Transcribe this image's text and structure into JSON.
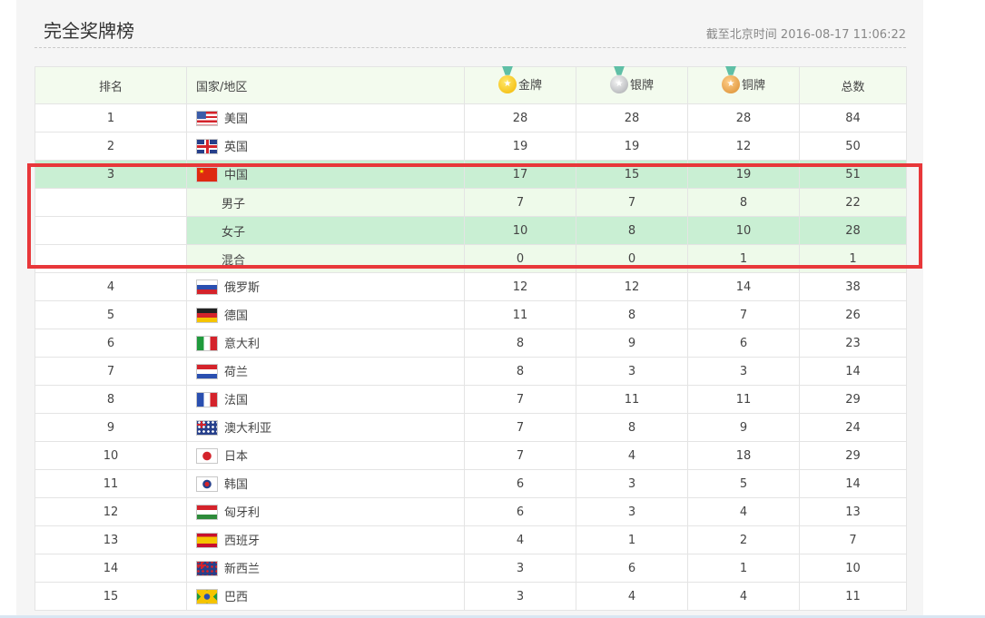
{
  "page": {
    "title": "完全奖牌榜",
    "updated": "截至北京时间 2016-08-17 11:06:22"
  },
  "table": {
    "headers": {
      "rank": "排名",
      "country": "国家/地区",
      "gold": "金牌",
      "silver": "银牌",
      "bronze": "铜牌",
      "total": "总数"
    },
    "rows": [
      {
        "rank": "1",
        "country": "美国",
        "gold": "28",
        "silver": "28",
        "bronze": "28",
        "total": "84",
        "flag": "us-flag-icon"
      },
      {
        "rank": "2",
        "country": "英国",
        "gold": "19",
        "silver": "19",
        "bronze": "12",
        "total": "50",
        "flag": "uk-flag-icon"
      },
      {
        "rank": "3",
        "country": "中国",
        "gold": "17",
        "silver": "15",
        "bronze": "19",
        "total": "51",
        "flag": "china-flag-icon"
      },
      {
        "rank": "4",
        "country": "俄罗斯",
        "gold": "12",
        "silver": "12",
        "bronze": "14",
        "total": "38",
        "flag": "russia-flag-icon"
      },
      {
        "rank": "5",
        "country": "德国",
        "gold": "11",
        "silver": "8",
        "bronze": "7",
        "total": "26",
        "flag": "germany-flag-icon"
      },
      {
        "rank": "6",
        "country": "意大利",
        "gold": "8",
        "silver": "9",
        "bronze": "6",
        "total": "23",
        "flag": "italy-flag-icon"
      },
      {
        "rank": "7",
        "country": "荷兰",
        "gold": "8",
        "silver": "3",
        "bronze": "3",
        "total": "14",
        "flag": "netherlands-flag-icon"
      },
      {
        "rank": "8",
        "country": "法国",
        "gold": "7",
        "silver": "11",
        "bronze": "11",
        "total": "29",
        "flag": "france-flag-icon"
      },
      {
        "rank": "9",
        "country": "澳大利亚",
        "gold": "7",
        "silver": "8",
        "bronze": "9",
        "total": "24",
        "flag": "australia-flag-icon"
      },
      {
        "rank": "10",
        "country": "日本",
        "gold": "7",
        "silver": "4",
        "bronze": "18",
        "total": "29",
        "flag": "japan-flag-icon"
      },
      {
        "rank": "11",
        "country": "韩国",
        "gold": "6",
        "silver": "3",
        "bronze": "5",
        "total": "14",
        "flag": "korea-flag-icon"
      },
      {
        "rank": "12",
        "country": "匈牙利",
        "gold": "6",
        "silver": "3",
        "bronze": "4",
        "total": "13",
        "flag": "hungary-flag-icon"
      },
      {
        "rank": "13",
        "country": "西班牙",
        "gold": "4",
        "silver": "1",
        "bronze": "2",
        "total": "7",
        "flag": "spain-flag-icon"
      },
      {
        "rank": "14",
        "country": "新西兰",
        "gold": "3",
        "silver": "6",
        "bronze": "1",
        "total": "10",
        "flag": "new-zealand-flag-icon"
      },
      {
        "rank": "15",
        "country": "巴西",
        "gold": "3",
        "silver": "4",
        "bronze": "4",
        "total": "11",
        "flag": "brazil-flag-icon"
      }
    ],
    "china_breakdown": [
      {
        "label": "男子",
        "gold": "7",
        "silver": "7",
        "bronze": "8",
        "total": "22"
      },
      {
        "label": "女子",
        "gold": "10",
        "silver": "8",
        "bronze": "10",
        "total": "28"
      },
      {
        "label": "混合",
        "gold": "0",
        "silver": "0",
        "bronze": "1",
        "total": "1"
      }
    ]
  },
  "colors": {
    "highlight_box": "#e8373a",
    "china_row": "#c9efd3",
    "header_bg": "#f3fbee"
  }
}
